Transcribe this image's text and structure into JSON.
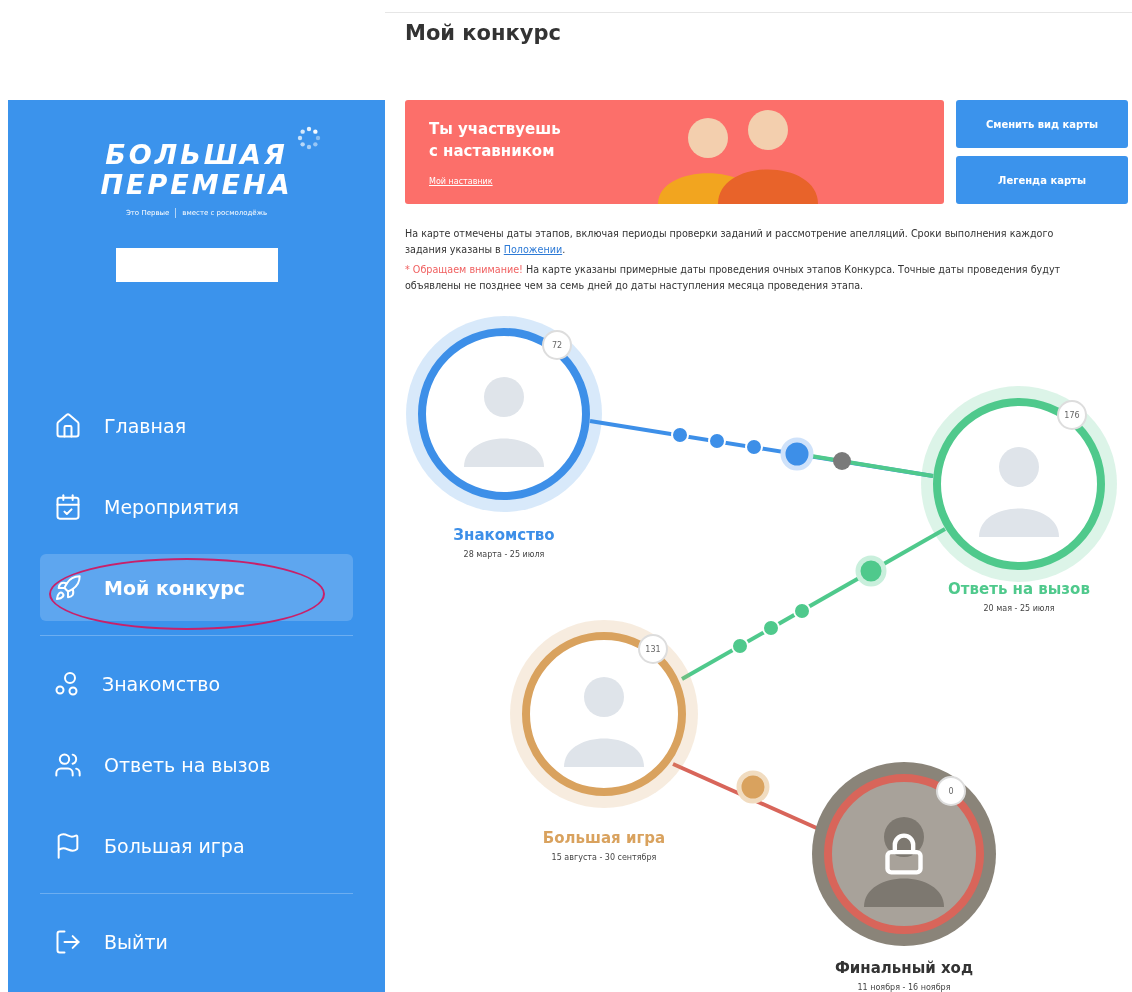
{
  "page_title": "Мой конкурс",
  "sidebar": {
    "logo": {
      "lines": [
        "БОЛЬШАЯ",
        "ПЕРЕМЕНА"
      ],
      "tagline": [
        "Это Первые",
        "вместе с росмолодёжь"
      ]
    },
    "groups": [
      {
        "items": [
          {
            "label": "Главная",
            "selected": false
          },
          {
            "label": "Мероприятия",
            "selected": false
          },
          {
            "label": "Мой конкурс",
            "selected": true
          }
        ]
      },
      {
        "items": [
          {
            "label": "Знакомство",
            "selected": false
          },
          {
            "label": "Ответь на вызов",
            "selected": false
          },
          {
            "label": "Большая игра",
            "selected": false
          }
        ]
      },
      {
        "items": [
          {
            "label": "Выйти",
            "selected": false
          }
        ]
      }
    ]
  },
  "banner": {
    "title": "Ты участвуешь с наставником",
    "link": "Мой наставник"
  },
  "buttons": [
    "Сменить вид карты",
    "Легенда карты"
  ],
  "info": {
    "text": "На карте отмечены даты этапов, включая периоды проверки заданий и рассмотрение апелляций. Сроки выполнения каждого задания указаны в ",
    "link": "Положении",
    "text_end": "."
  },
  "notice": {
    "alert": "* Обращаем внимание!",
    "text": " На карте указаны примерные даты проведения очных этапов Конкурса. Точные даты проведения будут объявлены не позднее чем за семь дней до даты наступления месяца проведения этапа."
  },
  "stages": [
    {
      "title": "Знакомство",
      "dates": "28 марта - 25 июля",
      "count": "72",
      "color": "#3d8fe8",
      "locked": false
    },
    {
      "title": "Ответь на вызов",
      "dates": "20 мая - 25 июля",
      "count": "176",
      "color": "#4fc98c",
      "locked": false
    },
    {
      "title": "Большая игра",
      "dates": "15 августа - 30 сентября",
      "count": "131",
      "color": "#d9a25e",
      "locked": false
    },
    {
      "title": "Финальный ход",
      "dates": "11 ноября - 16 ноября",
      "count": "0",
      "color": "#d8655a",
      "locked": true
    }
  ]
}
